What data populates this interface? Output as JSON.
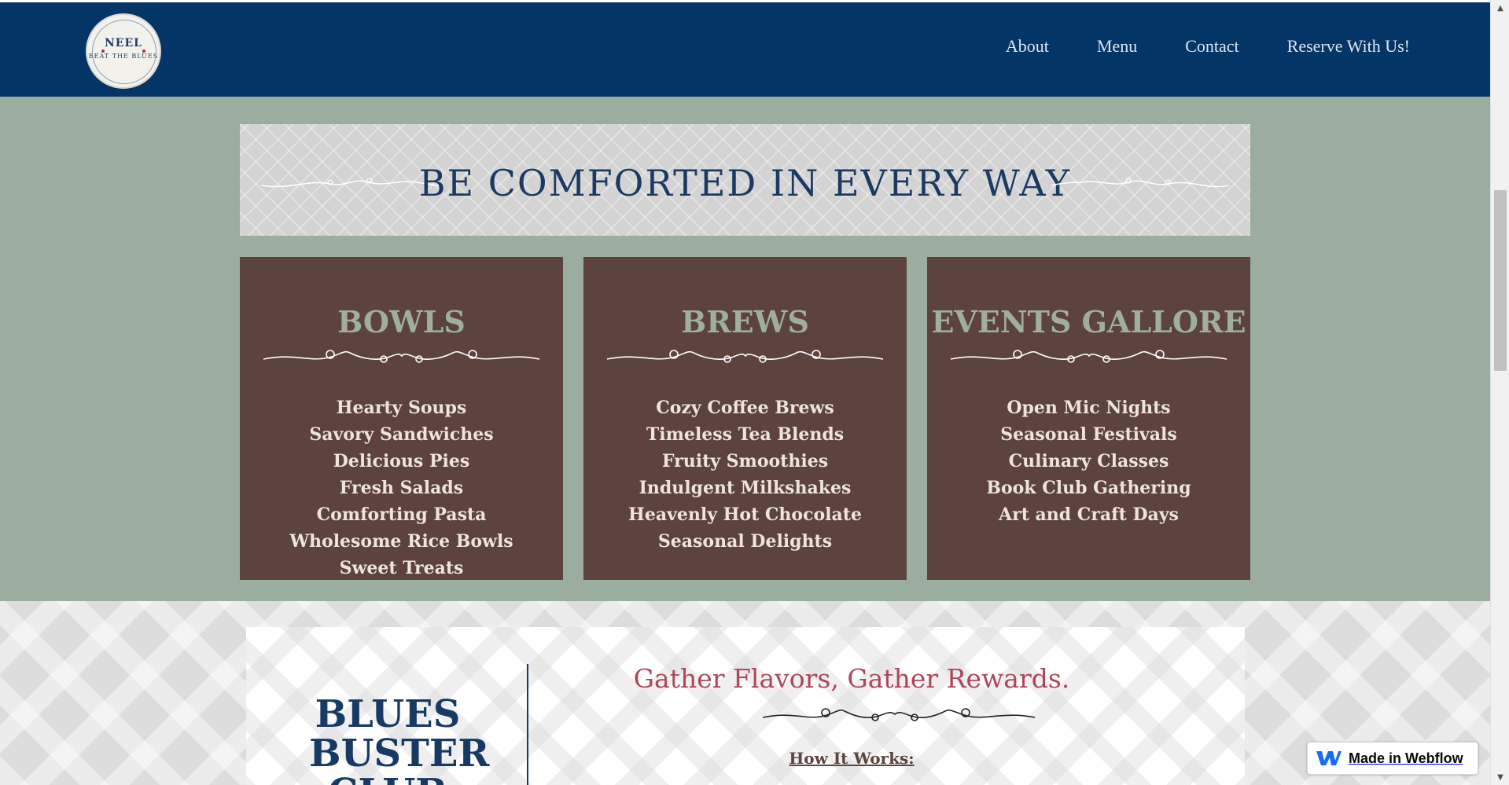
{
  "header": {
    "logo": {
      "name": "NEEL",
      "tagline": "BEAT THE BLUES"
    },
    "nav": [
      {
        "label": "About"
      },
      {
        "label": "Menu"
      },
      {
        "label": "Contact"
      },
      {
        "label": "Reserve With Us!"
      }
    ]
  },
  "banner": {
    "title": "BE COMFORTED IN EVERY WAY"
  },
  "cards": [
    {
      "title": "BOWLS",
      "items": [
        "Hearty Soups",
        "Savory Sandwiches",
        "Delicious Pies",
        "Fresh Salads",
        "Comforting Pasta",
        "Wholesome Rice Bowls",
        "Sweet Treats"
      ]
    },
    {
      "title": "BREWS",
      "items": [
        "Cozy Coffee Brews",
        "Timeless Tea Blends",
        "Fruity Smoothies",
        "Indulgent Milkshakes",
        "Heavenly Hot Chocolate",
        "Seasonal Delights"
      ]
    },
    {
      "title": "EVENTS GALLORE",
      "items": [
        "Open Mic Nights",
        "Seasonal Festivals",
        "Culinary Classes",
        "Book Club Gathering",
        "Art and Craft Days"
      ]
    }
  ],
  "club": {
    "title_lines": [
      "BLUES",
      "BUSTER",
      "CLUB"
    ],
    "heading": "Gather Flavors, Gather Rewards.",
    "how_it_works": "How It Works:"
  },
  "badge": {
    "label": "Made in Webflow"
  },
  "colors": {
    "header_bg": "#033566",
    "section_bg": "#9aad9f",
    "card_bg": "#5c433d",
    "card_title": "#9fae9f",
    "accent_red": "#b0455a",
    "navy_text": "#173a65"
  }
}
